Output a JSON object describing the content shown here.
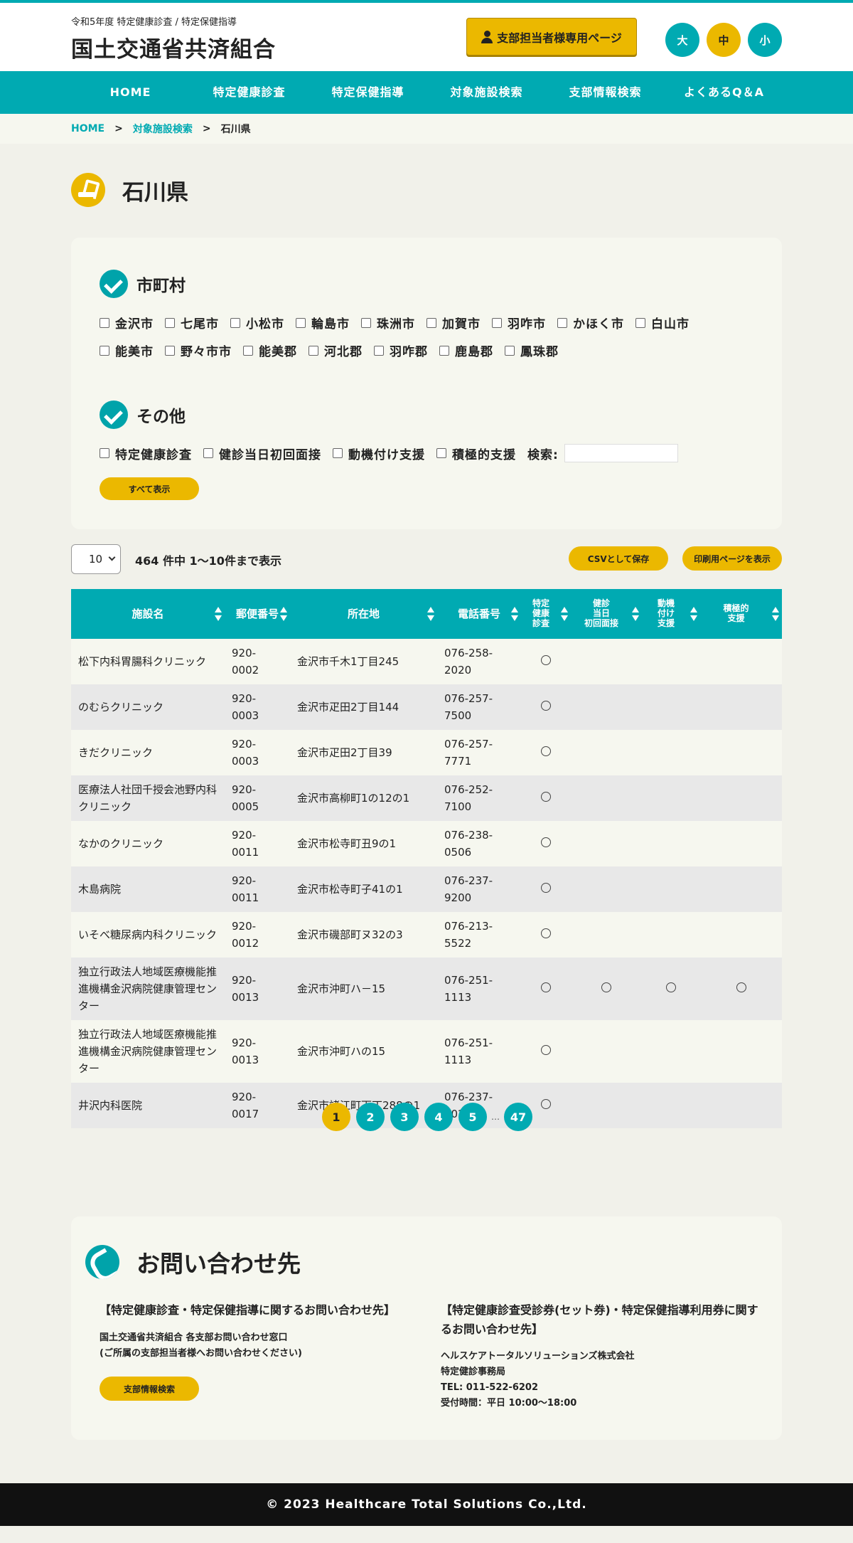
{
  "header": {
    "subtitle": "令和5年度 特定健康診査 / 特定保健指導",
    "brand": "国土交通省共済組合",
    "branch_button": "支部担当者様専用ページ",
    "font_sizes": [
      "大",
      "中",
      "小"
    ],
    "colors": {
      "accent": "#00aab2",
      "yellow": "#ebb800"
    }
  },
  "nav": [
    "HOME",
    "特定健康診査",
    "特定保健指導",
    "対象施設検索",
    "支部情報検索",
    "よくあるQ＆A"
  ],
  "breadcrumb": {
    "home": "HOME",
    "sep": ">",
    "section": "対象施設検索",
    "current": "石川県"
  },
  "page_title": "石川県",
  "filters": {
    "municipality_title": "市町村",
    "municipalities_row1": [
      "金沢市",
      "七尾市",
      "小松市",
      "輪島市",
      "珠洲市",
      "加賀市",
      "羽咋市",
      "かほく市",
      "白山市"
    ],
    "municipalities_row2": [
      "能美市",
      "野々市市",
      "能美郡",
      "河北郡",
      "羽咋郡",
      "鹿島郡",
      "鳳珠郡"
    ],
    "other_title": "その他",
    "other_options": [
      "特定健康診査",
      "健診当日初回面接",
      "動機付け支援",
      "積極的支援"
    ],
    "search_label": "検索:",
    "search_value": "",
    "show_all": "すべて表示"
  },
  "list": {
    "page_size": "10",
    "count_text": "464 件中 1〜10件まで表示",
    "csv_button": "CSVとして保存",
    "print_button": "印刷用ページを表示",
    "columns": [
      "施設名",
      "郵便番号",
      "所在地",
      "電話番号",
      "特定\n健康\n診査",
      "健診\n当日\n初回面接",
      "動機\n付け\n支援",
      "積極的\n支援"
    ],
    "rows": [
      {
        "name": "松下内科胃腸科クリニック",
        "zip": "920-0002",
        "addr": "金沢市千木1丁目245",
        "tel": "076-258-2020",
        "m1": "〇",
        "m2": "",
        "m3": "",
        "m4": ""
      },
      {
        "name": "のむらクリニック",
        "zip": "920-0003",
        "addr": "金沢市疋田2丁目144",
        "tel": "076-257-7500",
        "m1": "〇",
        "m2": "",
        "m3": "",
        "m4": ""
      },
      {
        "name": "きだクリニック",
        "zip": "920-0003",
        "addr": "金沢市疋田2丁目39",
        "tel": "076-257-7771",
        "m1": "〇",
        "m2": "",
        "m3": "",
        "m4": ""
      },
      {
        "name": "医療法人社団千授会池野内科クリニック",
        "zip": "920-0005",
        "addr": "金沢市高柳町1の12の1",
        "tel": "076-252-7100",
        "m1": "〇",
        "m2": "",
        "m3": "",
        "m4": ""
      },
      {
        "name": "なかのクリニック",
        "zip": "920-0011",
        "addr": "金沢市松寺町丑9の1",
        "tel": "076-238-0506",
        "m1": "〇",
        "m2": "",
        "m3": "",
        "m4": ""
      },
      {
        "name": "木島病院",
        "zip": "920-0011",
        "addr": "金沢市松寺町子41の1",
        "tel": "076-237-9200",
        "m1": "〇",
        "m2": "",
        "m3": "",
        "m4": ""
      },
      {
        "name": "いそべ糖尿病内科クリニック",
        "zip": "920-0012",
        "addr": "金沢市磯部町ヌ32の3",
        "tel": "076-213-5522",
        "m1": "〇",
        "m2": "",
        "m3": "",
        "m4": ""
      },
      {
        "name": "独立行政法人地域医療機能推進機構金沢病院健康管理センター",
        "zip": "920-0013",
        "addr": "金沢市沖町ハ－15",
        "tel": "076-251-1113",
        "m1": "〇",
        "m2": "〇",
        "m3": "〇",
        "m4": "〇"
      },
      {
        "name": "独立行政法人地域医療機能推進機構金沢病院健康管理センター",
        "zip": "920-0013",
        "addr": "金沢市沖町ハの15",
        "tel": "076-251-1113",
        "m1": "〇",
        "m2": "",
        "m3": "",
        "m4": ""
      },
      {
        "name": "井沢内科医院",
        "zip": "920-0017",
        "addr": "金沢市諸江町下丁288の1",
        "tel": "076-237-6026",
        "m1": "〇",
        "m2": "",
        "m3": "",
        "m4": ""
      }
    ],
    "pages": [
      "1",
      "2",
      "3",
      "4",
      "5",
      "47"
    ],
    "ellipsis": "…",
    "current_page": "1"
  },
  "contact": {
    "title": "お問い合わせ先",
    "left_heading": "【特定健康診査・特定保健指導に関するお問い合わせ先】",
    "left_text": "国土交通省共済組合 各支部お問い合わせ窓口\n(ご所属の支部担当者様へお問い合わせください)",
    "left_button": "支部情報検索",
    "right_heading": "【特定健康診査受診券(セット券)・特定保健指導利用券に関するお問い合わせ先】",
    "right_text": "ヘルスケアトータルソリューションズ株式会社\n特定健診事務局\nTEL: 011-522-6202\n受付時間：平日 10:00〜18:00"
  },
  "footer": "© 2023 Healthcare Total Solutions Co.,Ltd."
}
